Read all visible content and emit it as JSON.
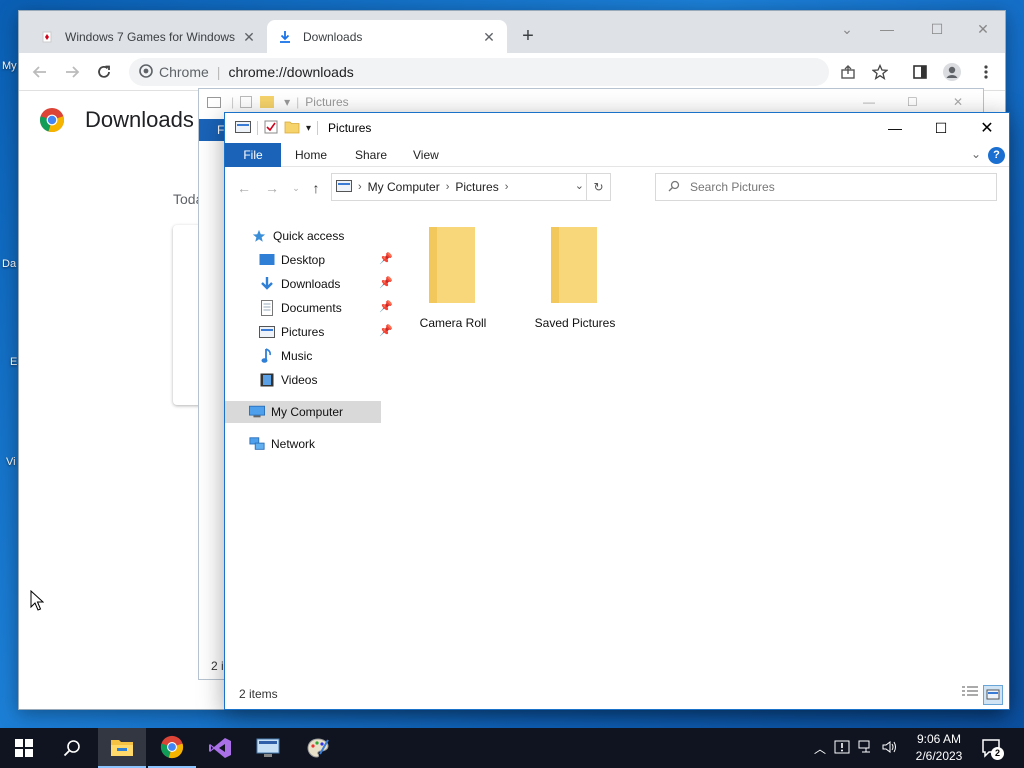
{
  "desktop": {
    "labels": [
      "My",
      "Da",
      "E",
      "Vi"
    ]
  },
  "chrome": {
    "tabs": [
      {
        "title": "Windows 7 Games for Windows",
        "active": false
      },
      {
        "title": "Downloads",
        "active": true
      }
    ],
    "new_tab_glyph": "+",
    "omnibox": {
      "site_label": "Chrome",
      "url": "chrome://downloads"
    },
    "page": {
      "title": "Downloads",
      "section": "Toda"
    }
  },
  "ghost_explorer": {
    "title": "Pictures",
    "file_tab": "F",
    "status": "2 i"
  },
  "explorer": {
    "title": "Pictures",
    "ribbon_tabs": [
      "File",
      "Home",
      "Share",
      "View"
    ],
    "help_glyph": "?",
    "address": {
      "crumbs": [
        "My Computer",
        "Pictures"
      ]
    },
    "search_placeholder": "Search Pictures",
    "nav": {
      "quick_access": "Quick access",
      "quick_items": [
        {
          "label": "Desktop",
          "icon": "desktop-icon",
          "pinned": true
        },
        {
          "label": "Downloads",
          "icon": "download-arrow-icon",
          "pinned": true
        },
        {
          "label": "Documents",
          "icon": "document-icon",
          "pinned": true
        },
        {
          "label": "Pictures",
          "icon": "pictures-icon",
          "pinned": true
        },
        {
          "label": "Music",
          "icon": "music-icon",
          "pinned": false
        },
        {
          "label": "Videos",
          "icon": "videos-icon",
          "pinned": false
        }
      ],
      "my_computer": "My Computer",
      "network": "Network"
    },
    "folders": [
      {
        "label": "Camera Roll"
      },
      {
        "label": "Saved Pictures"
      }
    ],
    "status": {
      "count": "2 items"
    }
  },
  "taskbar": {
    "time": "9:06 AM",
    "date": "2/6/2023",
    "notification_count": "2"
  },
  "colors": {
    "accent": "#1a63b8",
    "folder": "#f6d36b",
    "taskbar": "#0f1420"
  }
}
